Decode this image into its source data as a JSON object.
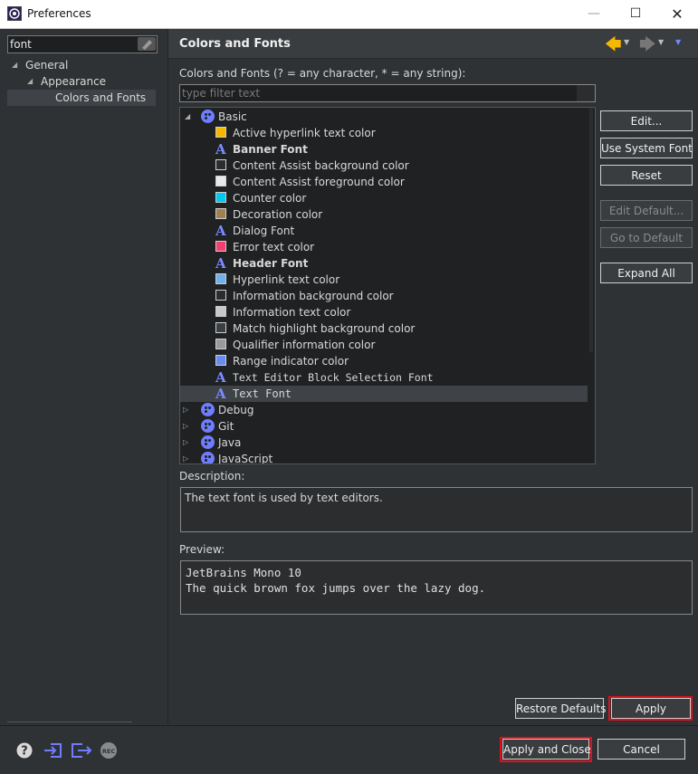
{
  "window": {
    "title": "Preferences",
    "minimize": "—",
    "maximize": "☐",
    "close": "✕"
  },
  "sidebar": {
    "search_value": "font",
    "items": [
      {
        "label": "General"
      },
      {
        "label": "Appearance"
      },
      {
        "label": "Colors and Fonts"
      }
    ]
  },
  "page": {
    "title": "Colors and Fonts",
    "filter_label": "Colors and Fonts (? = any character, * = any string):",
    "filter_placeholder": "type filter text",
    "description_label": "Description:",
    "description_text": "The text font is used by text editors.",
    "preview_label": "Preview:",
    "preview_line1": "JetBrains Mono 10",
    "preview_line2": "The quick brown fox jumps over the lazy dog."
  },
  "tree": {
    "basic": "Basic",
    "items": [
      {
        "label": "Active hyperlink text color",
        "color": "#f5b800"
      },
      {
        "label": "Banner Font"
      },
      {
        "label": "Content Assist background color",
        "color": "#2b2d2f"
      },
      {
        "label": "Content Assist foreground color",
        "color": "#e8e8e8"
      },
      {
        "label": "Counter color",
        "color": "#00c8f0"
      },
      {
        "label": "Decoration color",
        "color": "#a08050"
      },
      {
        "label": "Dialog Font"
      },
      {
        "label": "Error text color",
        "color": "#f04070"
      },
      {
        "label": "Header Font"
      },
      {
        "label": "Hyperlink text color",
        "color": "#6fb0e8"
      },
      {
        "label": "Information background color",
        "color": "#2b2d2f"
      },
      {
        "label": "Information text color",
        "color": "#c8c8c8"
      },
      {
        "label": "Match highlight background color",
        "color": "#3a3f44"
      },
      {
        "label": "Qualifier information color",
        "color": "#9a9a9a"
      },
      {
        "label": "Range indicator color",
        "color": "#6a8cf0"
      },
      {
        "label": "Text Editor Block Selection Font"
      },
      {
        "label": "Text Font"
      }
    ],
    "groups": [
      "Debug",
      "Git",
      "Java",
      "JavaScript"
    ]
  },
  "buttons": {
    "edit": "Edit...",
    "use_system_font": "Use System Font",
    "reset": "Reset",
    "edit_default": "Edit Default...",
    "go_to_default": "Go to Default",
    "expand_all": "Expand All",
    "restore_defaults": "Restore Defaults",
    "apply": "Apply",
    "apply_and_close": "Apply and Close",
    "cancel": "Cancel"
  },
  "bottom_icons": {
    "help": "?",
    "rec": "REC"
  },
  "colors": {
    "accent_arrow": "#f5b800",
    "highlight_border": "#e0101c",
    "palette_icon": "#6f7dff"
  }
}
